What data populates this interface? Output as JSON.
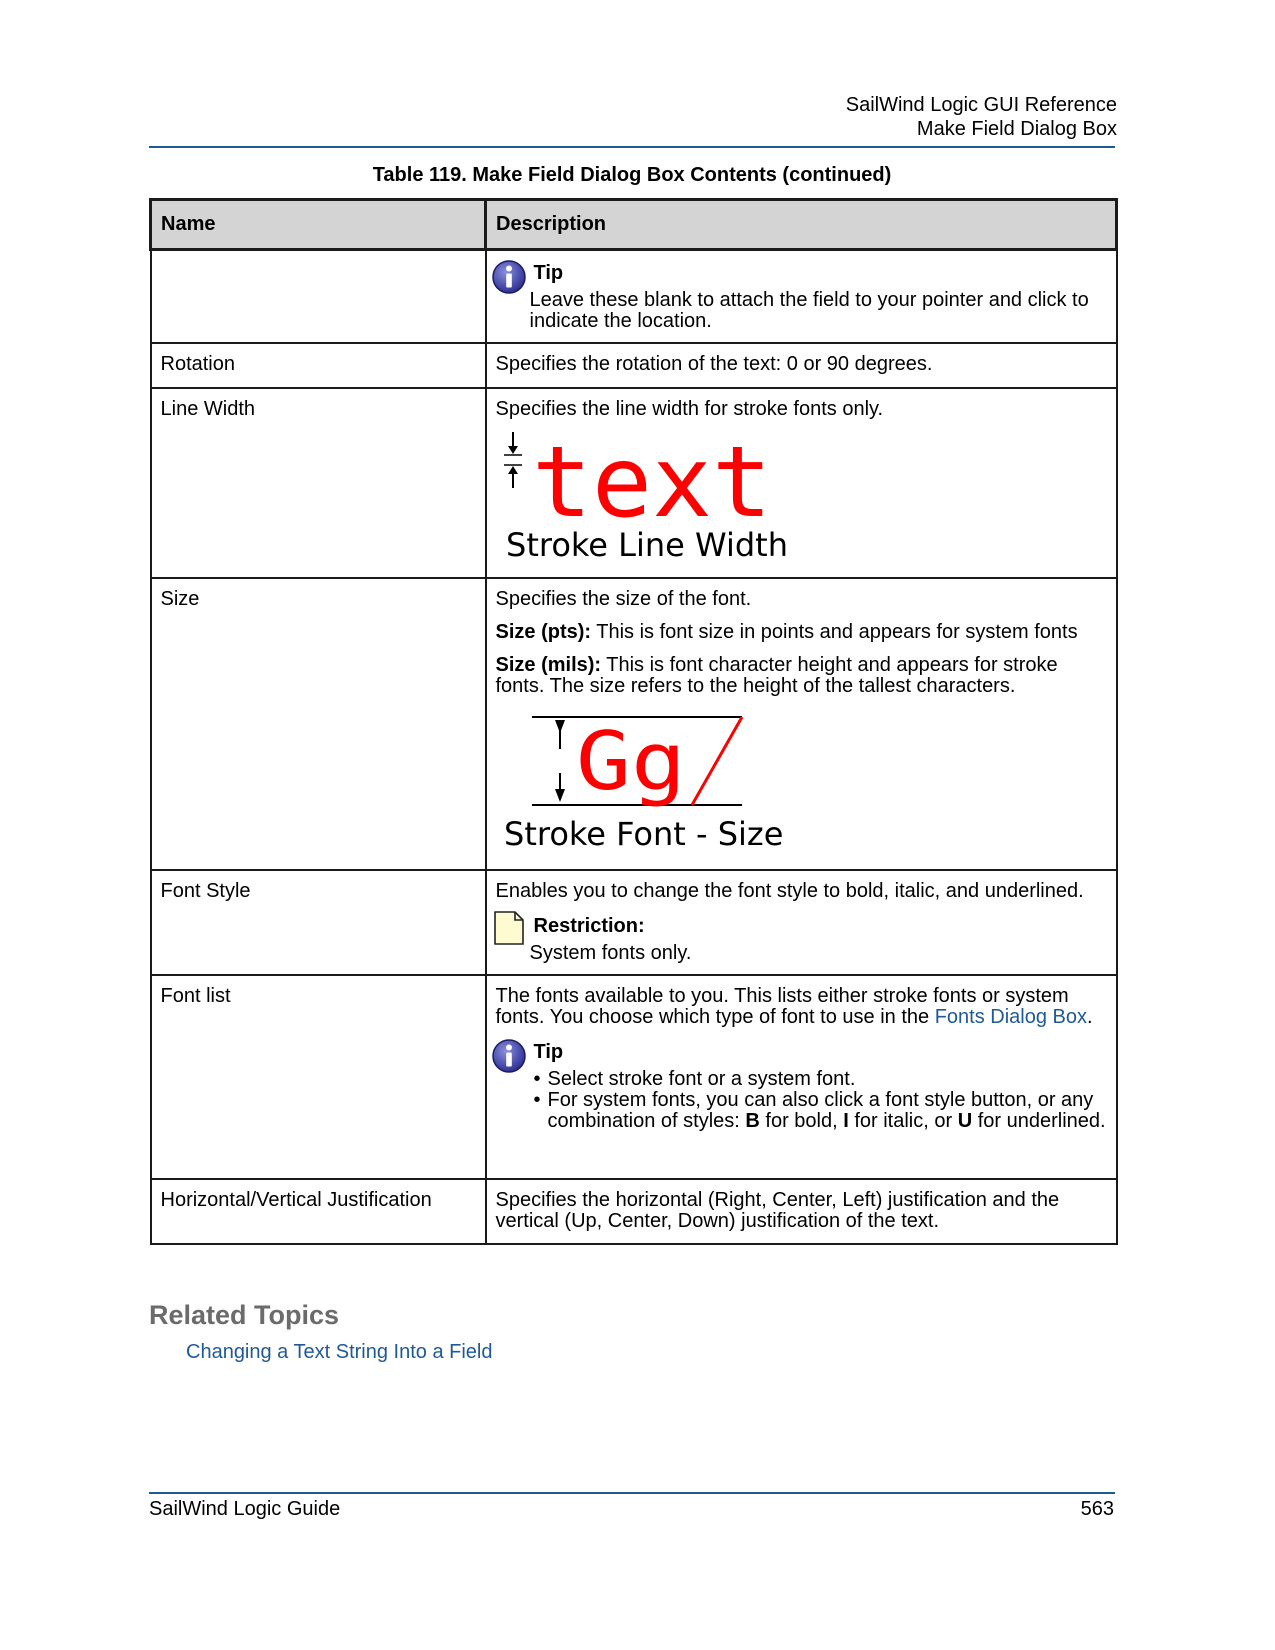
{
  "header": {
    "line1": "SailWind Logic GUI Reference",
    "line2": "Make Field Dialog Box"
  },
  "table": {
    "caption": "Table 119. Make Field Dialog Box Contents (continued)",
    "col_name": "Name",
    "col_desc": "Description",
    "rows": [
      {
        "name": "",
        "tip_title": "Tip",
        "tip_text": "Leave these blank to attach the field to your pointer and click to indicate the location."
      },
      {
        "name": "Rotation",
        "desc": "Specifies the rotation of the text: 0 or 90 degrees."
      },
      {
        "name": "Line Width",
        "desc": "Specifies the line width for stroke fonts only.",
        "figure_word": "text",
        "figure_caption": "Stroke Line Width"
      },
      {
        "name": "Size",
        "desc": "Specifies the size of the font.",
        "pts_label": "Size (pts):",
        "pts_text": " This is font size in points and appears for system fonts",
        "mils_label": "Size (mils):",
        "mils_text": " This is font character height and appears for stroke fonts. The size refers to the height of the tallest characters.",
        "figure_word": "Gg",
        "figure_caption": "Stroke Font - Size"
      },
      {
        "name": "Font Style",
        "desc": "Enables you to change the font style to bold, italic, and underlined.",
        "restriction_title": "Restriction:",
        "restriction_text": "System fonts only."
      },
      {
        "name": "Font list",
        "desc_pre": "The fonts available to you. This lists either stroke fonts or system fonts. You choose which type of font to use in the ",
        "desc_link": "Fonts Dialog Box",
        "desc_post": ".",
        "tip_title": "Tip",
        "bullet1": "Select stroke font or a system font.",
        "bullet2_pre": "For system fonts, you can also click a font style button, or any combination of styles: ",
        "bullet2_b": "B",
        "bullet2_mid1": " for bold, ",
        "bullet2_i": "I",
        "bullet2_mid2": " for italic, or ",
        "bullet2_u": "U",
        "bullet2_post": " for underlined."
      },
      {
        "name": "Horizontal/Vertical Justification",
        "desc": "Specifies the horizontal (Right, Center, Left) justification and the vertical (Up, Center, Down) justification of the text."
      }
    ]
  },
  "related": {
    "title": "Related Topics",
    "link": "Changing a Text String Into a Field"
  },
  "footer": {
    "left": "SailWind Logic Guide",
    "page": "563"
  },
  "colors": {
    "accent": "#1f5a96",
    "figure_red": "#ff0000",
    "header_bg": "#d4d4d4",
    "tip_icon": "#2e3192"
  }
}
